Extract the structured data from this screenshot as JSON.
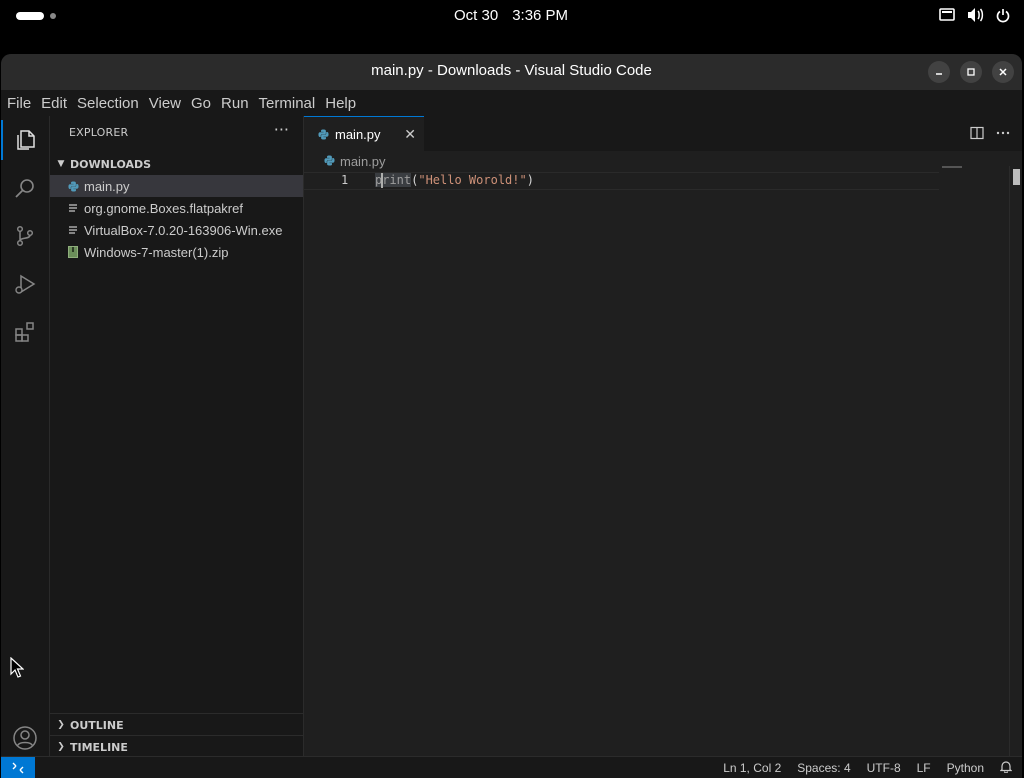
{
  "topbar": {
    "date": "Oct 30",
    "time": "3:36 PM"
  },
  "window": {
    "title": "main.py - Downloads - Visual Studio Code"
  },
  "menu": [
    "File",
    "Edit",
    "Selection",
    "View",
    "Go",
    "Run",
    "Terminal",
    "Help"
  ],
  "sidebar": {
    "header": "EXPLORER",
    "more": "···",
    "folder": "DOWNLOADS",
    "files": [
      {
        "name": "main.py",
        "icon": "python-file-icon"
      },
      {
        "name": "org.gnome.Boxes.flatpakref",
        "icon": "text-file-icon"
      },
      {
        "name": "VirtualBox-7.0.20-163906-Win.exe",
        "icon": "text-file-icon"
      },
      {
        "name": "Windows-7-master(1).zip",
        "icon": "zip-file-icon"
      }
    ],
    "outline": "OUTLINE",
    "timeline": "TIMELINE"
  },
  "editor": {
    "tab": "main.py",
    "tab_close": "✕",
    "breadcrumb": "main.py",
    "line_number": "1",
    "code": {
      "fn": "print",
      "open": "(",
      "str": "\"Hello Worold!\"",
      "close": ")"
    }
  },
  "status": {
    "position": "Ln 1, Col 2",
    "spaces": "Spaces: 4",
    "encoding": "UTF-8",
    "eol": "LF",
    "language": "Python"
  },
  "colors": {
    "accent": "#0078d4",
    "string": "#ce9178",
    "background": "#1f1f1f"
  }
}
